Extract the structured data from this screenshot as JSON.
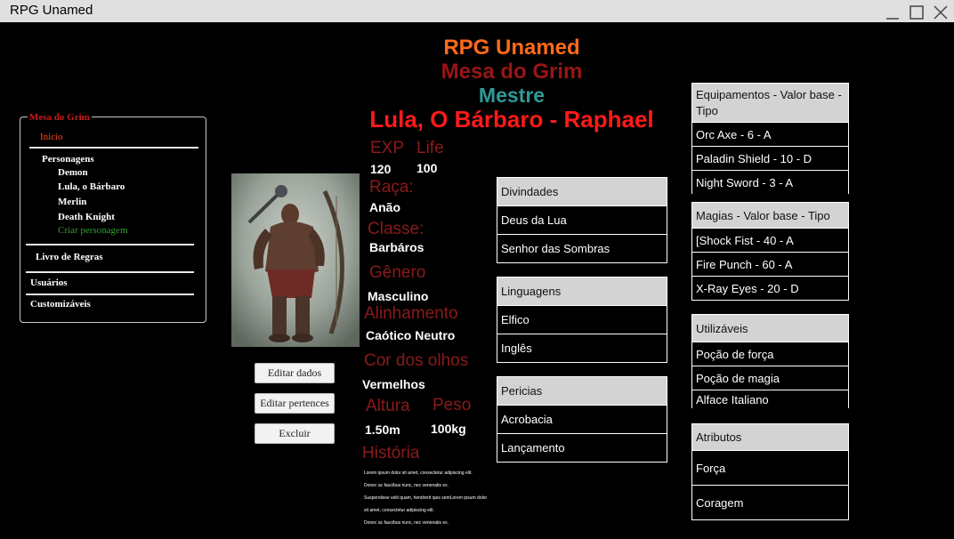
{
  "window": {
    "title": "RPG Unamed"
  },
  "header": {
    "app_name": "RPG Unamed",
    "table_name": "Mesa do Grim",
    "role": "Mestre",
    "character": "Lula, O Bárbaro - Raphael"
  },
  "sidebar": {
    "legend": "Mesa do Grim",
    "home": "Inicio",
    "characters_heading": "Personagens",
    "characters": [
      "Demon",
      "Lula, o Bárbaro",
      "Merlin",
      "Death Knight"
    ],
    "create_character": "Criar personagem",
    "rulebook": "Livro de Regras",
    "users": "Usuários",
    "customizables": "Customizáveis"
  },
  "buttons": {
    "edit_data": "Editar dados",
    "edit_belongings": "Editar pertences",
    "delete": "Excluir"
  },
  "stats": {
    "exp_label": "EXP",
    "exp_value": "120",
    "life_label": "Life",
    "life_value": "100",
    "race_label": "Raça:",
    "race_value": "Anão",
    "class_label": "Classe:",
    "class_value": "Barbáros",
    "gender_label": "Gênero",
    "gender_value": "Masculino",
    "alignment_label": "Alinhamento",
    "alignment_value": "Caótico Neutro",
    "eye_color_label": "Cor dos olhos",
    "eye_color_value": "Vermelhos",
    "height_label": "Altura",
    "height_value": "1.50m",
    "weight_label": "Peso",
    "weight_value": "100kg",
    "history_label": "História",
    "history_lines": [
      "Lorem ipsum dolor sit amet, consectetur adipiscing elit.",
      "Donec ac faucibus nunc, nec venenatis ex.",
      "Suspendisse velit quam, hendrerit quis semLorem ipsum dolor",
      " sit amet, consectetur adipiscing elit.",
      " Donec ac faucibus nunc, nec venenatis ex."
    ]
  },
  "deities": {
    "header": "Divindades",
    "rows": [
      "Deus da Lua",
      "Senhor das Sombras"
    ]
  },
  "languages": {
    "header": "Linguagens",
    "rows": [
      "Elfico",
      "Inglês"
    ]
  },
  "skills": {
    "header": "Pericias",
    "rows": [
      "Acrobacia",
      "Lançamento"
    ]
  },
  "equipment": {
    "header": "Equipamentos - Valor base - Tipo",
    "rows": [
      "Orc Axe - 6 - A",
      "Paladin Shield - 10 - D",
      "Night Sword - 3 - A"
    ]
  },
  "magic": {
    "header": "Magias - Valor base - Tipo",
    "rows": [
      "[Shock Fist - 40 - A",
      "Fire Punch - 60 - A",
      "X-Ray Eyes - 20 - D"
    ]
  },
  "usables": {
    "header": "Utilizáveis",
    "rows": [
      "Poção de força",
      "Poção de magia",
      "Alface Italiano"
    ]
  },
  "attributes": {
    "header": "Atributos",
    "rows": [
      "Força",
      "Coragem"
    ]
  },
  "colors": {
    "app_name": "#ff6a1a",
    "table_name": "#9a1515",
    "role": "#2e9a96",
    "character": "#ff1a1a",
    "label": "#8b1a1a",
    "home_link": "#ff4a1a",
    "create_link": "#2fa02f"
  }
}
